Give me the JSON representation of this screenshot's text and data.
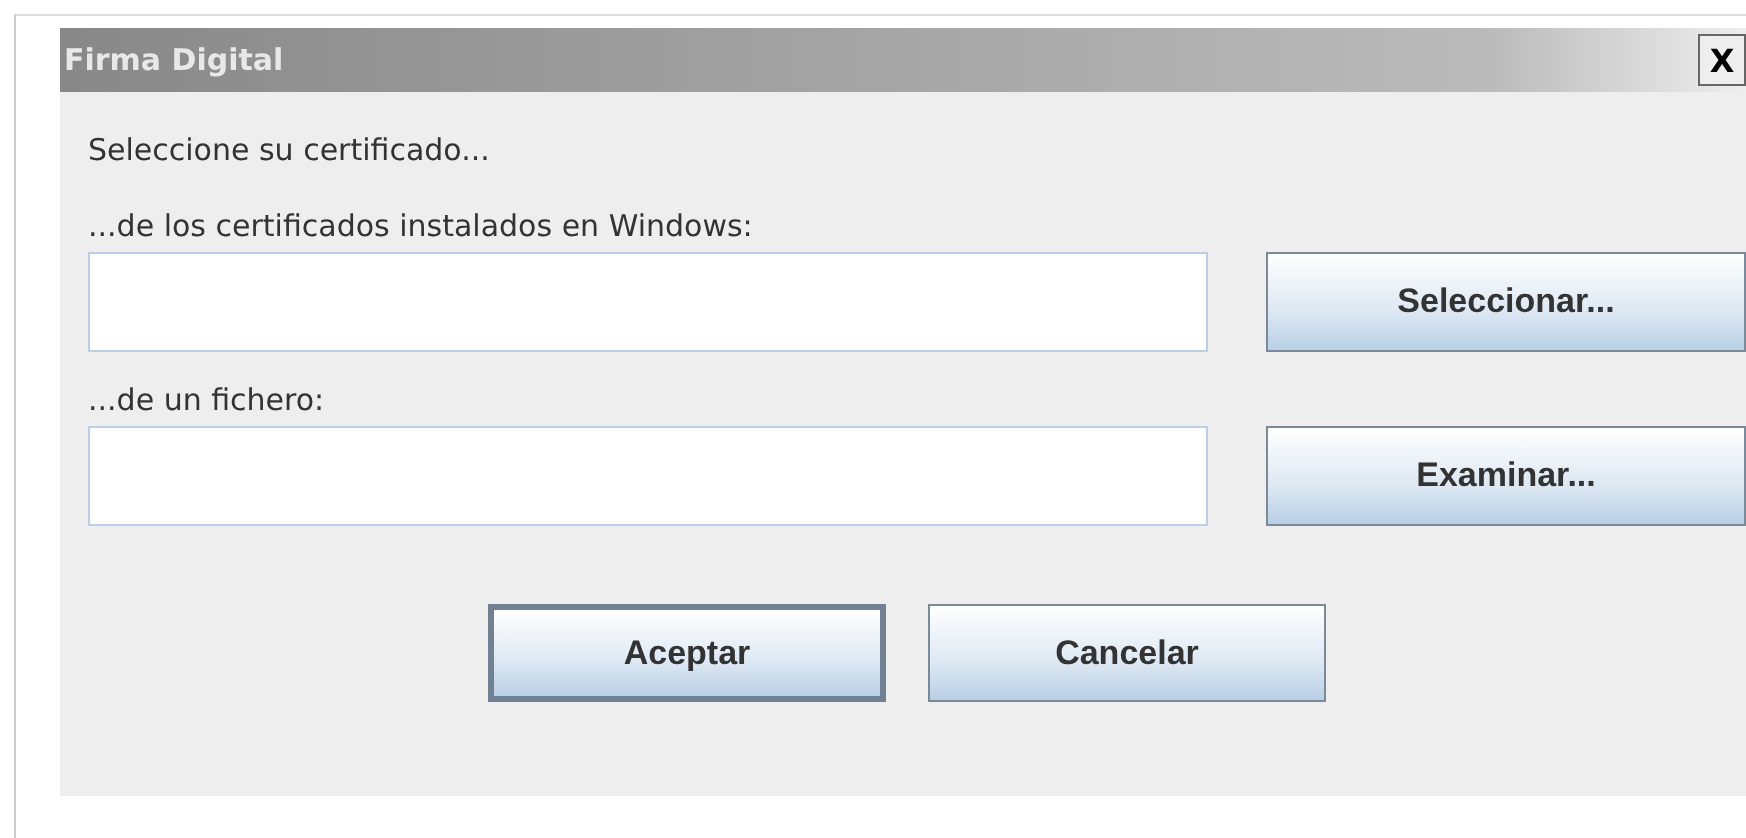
{
  "window": {
    "title": "Firma Digital",
    "close": "X"
  },
  "heading": "Seleccione su certificado...",
  "sources": [
    {
      "label": "...de los certificados instalados en Windows:",
      "button": "Seleccionar..."
    },
    {
      "label": "...de un fichero:",
      "button": "Examinar..."
    }
  ],
  "buttons": [
    {
      "label": "Aceptar",
      "default": true
    },
    {
      "label": "Cancelar",
      "default": false
    }
  ]
}
